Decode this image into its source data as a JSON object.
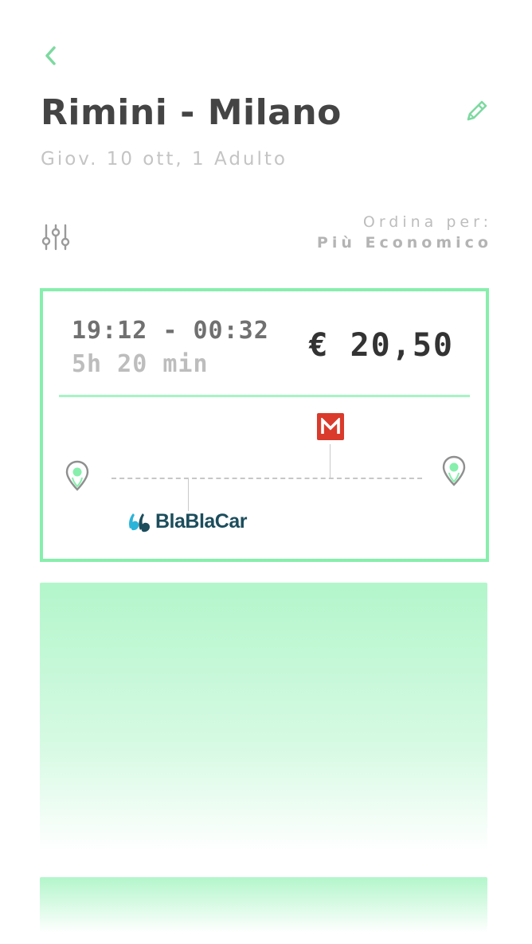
{
  "header": {
    "title": "Rimini - Milano",
    "subtitle": "Giov. 10 ott, 1 Adulto"
  },
  "sort": {
    "label": "Ordina per:",
    "value": "Più Economico"
  },
  "results": [
    {
      "times": "19:12 - 00:32",
      "duration": "5h 20 min",
      "price": "€ 20,50",
      "carriers": [
        {
          "name": "BlaBlaCar",
          "icon": "blablacar-logo"
        },
        {
          "name": "M",
          "icon": "metro-icon"
        }
      ]
    }
  ],
  "icons": {
    "back": "chevron-left-icon",
    "edit": "pencil-icon",
    "filter": "sliders-icon",
    "origin": "map-pin-icon",
    "destination": "map-pin-icon"
  },
  "colors": {
    "accent": "#86efac",
    "title": "#444444",
    "metro": "#d93a2b",
    "blablacar": "#1b4d5c",
    "placeholder": "#b3f6cb"
  }
}
